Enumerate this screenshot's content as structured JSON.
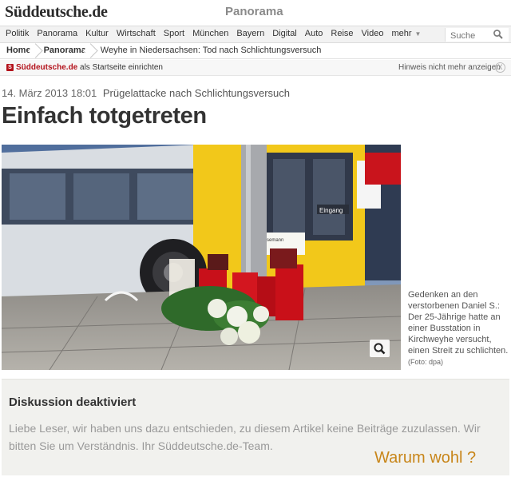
{
  "header": {
    "logo": "Süddeutsche.de",
    "section": "Panorama"
  },
  "nav": {
    "items": [
      "Politik",
      "Panorama",
      "Kultur",
      "Wirtschaft",
      "Sport",
      "München",
      "Bayern",
      "Digital",
      "Auto",
      "Reise",
      "Video"
    ],
    "more_label": "mehr",
    "search_placeholder": "Suche"
  },
  "breadcrumb": {
    "home": "Home",
    "section": "Panorama",
    "current": "Weyhe in Niedersachsen: Tod nach Schlichtungsversuch"
  },
  "startbar": {
    "brand": "Süddeutsche.de",
    "text": " als Startseite einrichten",
    "hide_hint": "Hinweis nicht mehr anzeigen",
    "close_label": "X"
  },
  "article": {
    "date": "14. März 2013 18:01",
    "kicker": "Prügelattacke nach Schlichtungsversuch",
    "headline": "Einfach totgetreten",
    "caption": "Gedenken an den verstorbenen Daniel S.: Der 25-Jährige hatte an einer Busstation in Kirchweyhe versucht, einen Streit zu schlichten.",
    "credit": "(Foto: dpa)",
    "photo_bus_sign": "Eingang",
    "photo_bus_company": "Joh. H. Mosemann"
  },
  "discussion": {
    "title": "Diskussion deaktiviert",
    "text": "Liebe Leser, wir haben uns dazu entschieden, zu diesem Artikel keine Beiträge zuzulassen. Wir bitten Sie um Verständnis. Ihr Süddeutsche.de-Team."
  },
  "annotation": "Warum wohl ?"
}
